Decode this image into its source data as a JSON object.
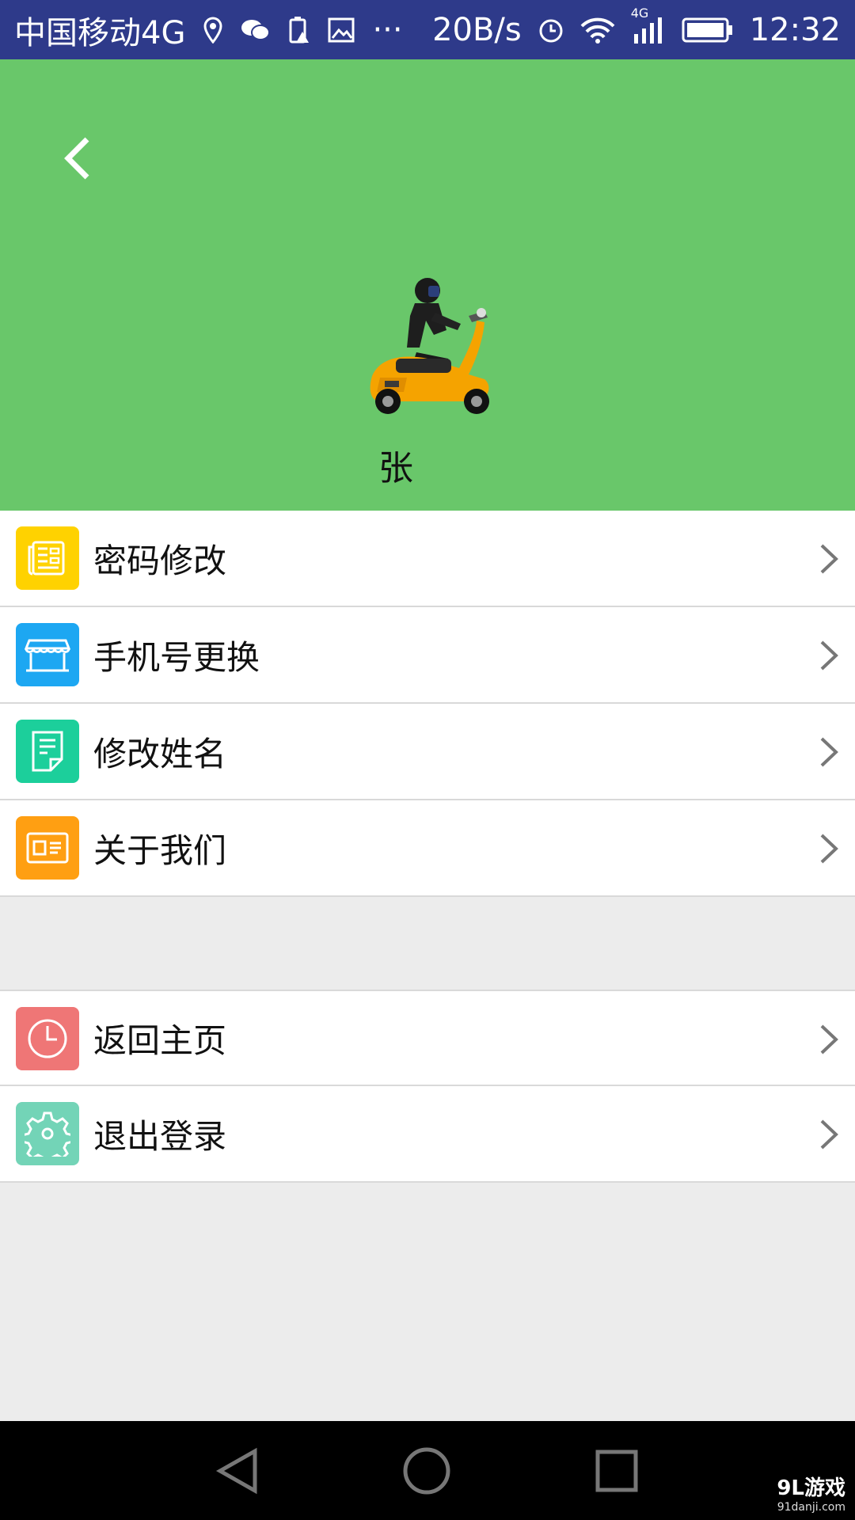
{
  "status_bar": {
    "carrier": "中国移动4G",
    "more": "···",
    "net_speed": "20B/s",
    "network_type": "4G",
    "time": "12:32"
  },
  "header": {
    "user_name": "张",
    "bg_color": "#69c76a"
  },
  "menu": {
    "group1": [
      {
        "label": "密码修改",
        "icon": "newspaper-icon",
        "color": "#ffd200"
      },
      {
        "label": "手机号更换",
        "icon": "storefront-icon",
        "color": "#1da7f2"
      },
      {
        "label": "修改姓名",
        "icon": "document-icon",
        "color": "#1ccf9b"
      },
      {
        "label": "关于我们",
        "icon": "id-card-icon",
        "color": "#ff9f12"
      }
    ],
    "group2": [
      {
        "label": "返回主页",
        "icon": "clock-icon",
        "color": "#ef7676"
      },
      {
        "label": "退出登录",
        "icon": "gear-icon",
        "color": "#73d4b7"
      }
    ]
  },
  "watermark": {
    "logo": "9L游戏",
    "domain": "91danji.com"
  }
}
